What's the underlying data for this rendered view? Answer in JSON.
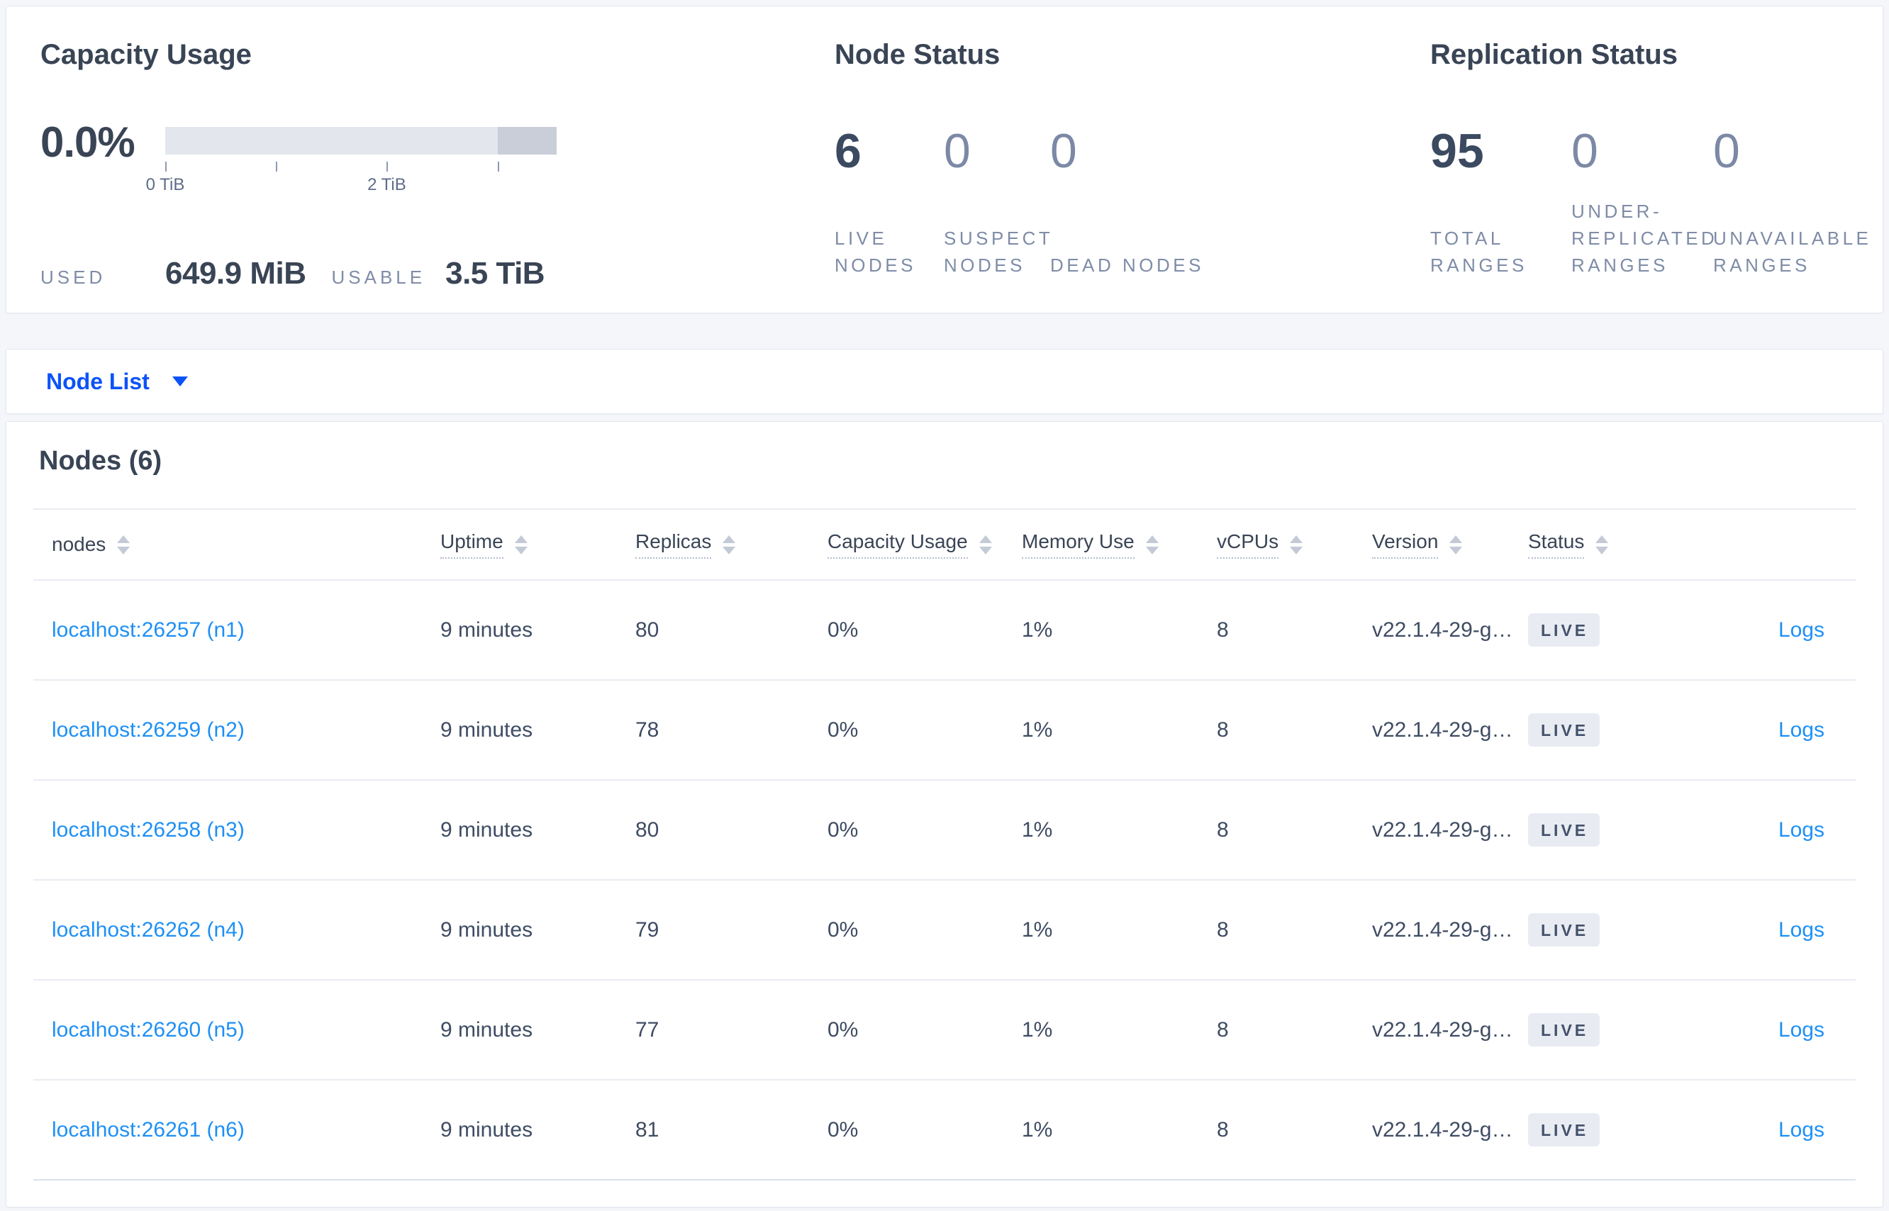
{
  "summary": {
    "capacity": {
      "title": "Capacity Usage",
      "percent": "0.0%",
      "used_label": "USED",
      "used_value": "649.9 MiB",
      "usable_label": "USABLE",
      "usable_value": "3.5 TiB",
      "gauge": {
        "track_color": "#e3e6ed",
        "dark_segment_color": "#c9ced9",
        "dark_from_pct": 85,
        "ticks_pct": [
          0,
          28.3,
          56.6,
          85
        ],
        "tick_labels": [
          {
            "text": "0 TiB",
            "pct": 0
          },
          {
            "text": "2 TiB",
            "pct": 56.6
          }
        ]
      }
    },
    "node_status": {
      "title": "Node Status",
      "stats": [
        {
          "value": "6",
          "label": "LIVE NODES",
          "dim": false
        },
        {
          "value": "0",
          "label": "SUSPECT NODES",
          "dim": true
        },
        {
          "value": "0",
          "label": "DEAD NODES",
          "dim": true
        }
      ]
    },
    "replication": {
      "title": "Replication Status",
      "stats": [
        {
          "value": "95",
          "label": "TOTAL RANGES",
          "dim": false
        },
        {
          "value": "0",
          "label": "UNDER-REPLICATED RANGES",
          "dim": true
        },
        {
          "value": "0",
          "label": "UNAVAILABLE RANGES",
          "dim": true
        }
      ]
    }
  },
  "node_list_dropdown": {
    "label": "Node List"
  },
  "nodes_panel": {
    "title": "Nodes (6)",
    "columns": [
      {
        "label": "nodes",
        "sortable": true,
        "tooltip_underline": false
      },
      {
        "label": "Uptime",
        "sortable": true,
        "tooltip_underline": true
      },
      {
        "label": "Replicas",
        "sortable": true,
        "tooltip_underline": true
      },
      {
        "label": "Capacity Usage",
        "sortable": true,
        "tooltip_underline": true
      },
      {
        "label": "Memory Use",
        "sortable": true,
        "tooltip_underline": true
      },
      {
        "label": "vCPUs",
        "sortable": true,
        "tooltip_underline": true
      },
      {
        "label": "Version",
        "sortable": true,
        "tooltip_underline": true
      },
      {
        "label": "Status",
        "sortable": true,
        "tooltip_underline": true
      },
      {
        "label": "",
        "sortable": false,
        "tooltip_underline": false
      }
    ],
    "rows": [
      {
        "name": "localhost:26257 (n1)",
        "uptime": "9 minutes",
        "replicas": "80",
        "capacity_usage": "0%",
        "memory_use": "1%",
        "vcpus": "8",
        "version": "v22.1.4-29-g…",
        "status": "LIVE",
        "logs_label": "Logs"
      },
      {
        "name": "localhost:26259 (n2)",
        "uptime": "9 minutes",
        "replicas": "78",
        "capacity_usage": "0%",
        "memory_use": "1%",
        "vcpus": "8",
        "version": "v22.1.4-29-g…",
        "status": "LIVE",
        "logs_label": "Logs"
      },
      {
        "name": "localhost:26258 (n3)",
        "uptime": "9 minutes",
        "replicas": "80",
        "capacity_usage": "0%",
        "memory_use": "1%",
        "vcpus": "8",
        "version": "v22.1.4-29-g…",
        "status": "LIVE",
        "logs_label": "Logs"
      },
      {
        "name": "localhost:26262 (n4)",
        "uptime": "9 minutes",
        "replicas": "79",
        "capacity_usage": "0%",
        "memory_use": "1%",
        "vcpus": "8",
        "version": "v22.1.4-29-g…",
        "status": "LIVE",
        "logs_label": "Logs"
      },
      {
        "name": "localhost:26260 (n5)",
        "uptime": "9 minutes",
        "replicas": "77",
        "capacity_usage": "0%",
        "memory_use": "1%",
        "vcpus": "8",
        "version": "v22.1.4-29-g…",
        "status": "LIVE",
        "logs_label": "Logs"
      },
      {
        "name": "localhost:26261 (n6)",
        "uptime": "9 minutes",
        "replicas": "81",
        "capacity_usage": "0%",
        "memory_use": "1%",
        "vcpus": "8",
        "version": "v22.1.4-29-g…",
        "status": "LIVE",
        "logs_label": "Logs"
      }
    ]
  },
  "colors": {
    "page_background": "#f4f6fa",
    "card_background": "#ffffff",
    "heading_text": "#394455",
    "muted_label": "#7f8ca7",
    "dim_stat": "#7c89a6",
    "link_blue": "#1e90f5",
    "dropdown_blue": "#0b53f7",
    "badge_background": "#e8ecf2",
    "badge_text": "#44516b",
    "divider": "#e9ecf2"
  }
}
